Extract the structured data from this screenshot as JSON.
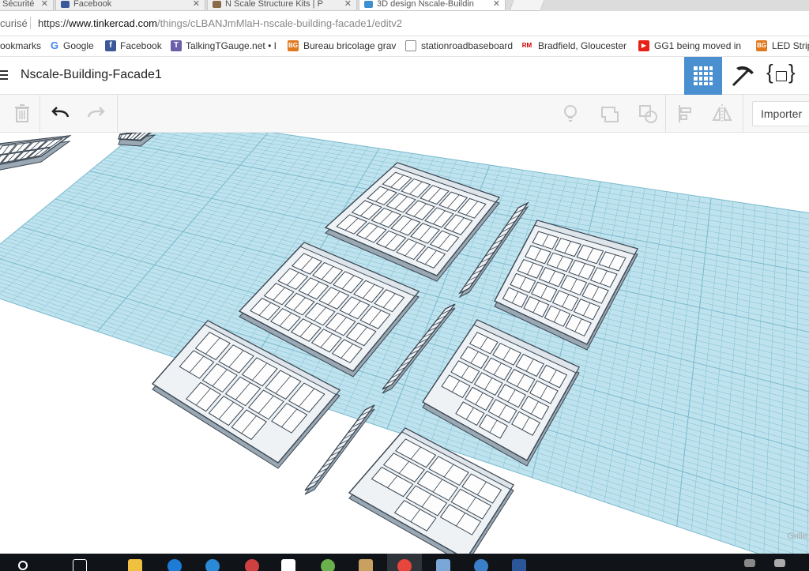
{
  "browser": {
    "tabs": [
      {
        "label": "Sécurité",
        "active": false
      },
      {
        "label": "Facebook",
        "active": false
      },
      {
        "label": "N Scale Structure Kits | P",
        "active": false
      },
      {
        "label": "3D design Nscale-Buildin",
        "active": true
      }
    ],
    "security_label": "curisé",
    "url_scheme": "https://",
    "url_host": "www.tinkercad.com",
    "url_path": "/things/cLBANJmMlaH-nscale-building-facade1/editv2"
  },
  "bookmarks": [
    {
      "label": "ookmarks",
      "icon": "none"
    },
    {
      "label": "Google",
      "icon": "google-icon"
    },
    {
      "label": "Facebook",
      "icon": "facebook-icon"
    },
    {
      "label": "TalkingTGauge.net • I",
      "icon": "talkingt-icon"
    },
    {
      "label": "Bureau bricolage grav",
      "icon": "bg-icon"
    },
    {
      "label": "stationroadbaseboard",
      "icon": "page-icon"
    },
    {
      "label": "Bradfield, Gloucester",
      "icon": "rm-icon"
    },
    {
      "label": "GG1 being moved in",
      "icon": "youtube-icon"
    },
    {
      "label": "LED Strip",
      "icon": "bg-icon"
    }
  ],
  "app": {
    "design_title": "Nscale-Building-Facade1",
    "importer_label": "Importer",
    "grid_label": "Grille",
    "accent": "#4a8fd0",
    "plane_color": "#bfe3ee",
    "grid_line_color": "#7fbcd0"
  }
}
